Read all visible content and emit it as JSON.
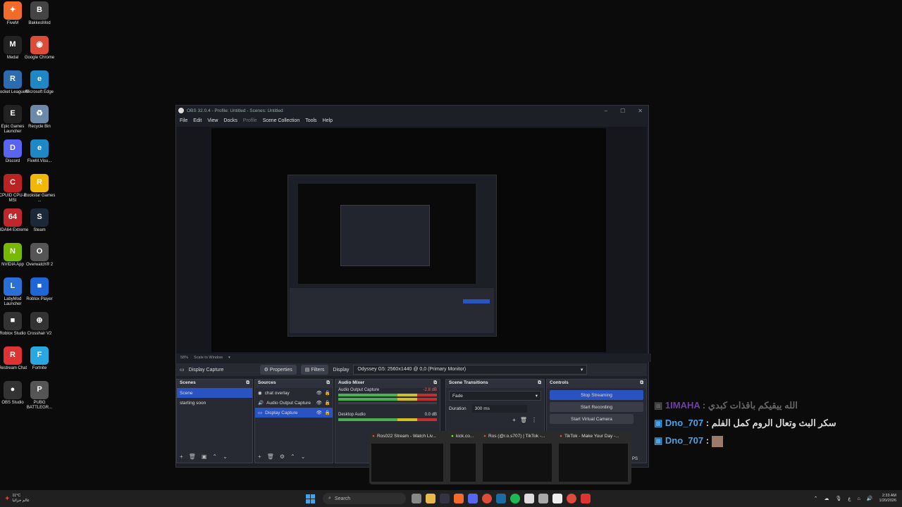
{
  "desktop": {
    "icons": [
      {
        "label": "FiveM",
        "color": "#f26b2a",
        "glyph": "✦"
      },
      {
        "label": "BakkesMod",
        "color": "#444",
        "glyph": "B"
      },
      {
        "label": "Medal",
        "color": "#222",
        "glyph": "M"
      },
      {
        "label": "Google Chrome",
        "color": "#dd4b39",
        "glyph": "◉"
      },
      {
        "label": "Rocket League®",
        "color": "#2b6cb0",
        "glyph": "R"
      },
      {
        "label": "Microsoft Edge",
        "color": "#1e88c7",
        "glyph": "e"
      },
      {
        "label": "Epic Games Launcher",
        "color": "#222",
        "glyph": "E"
      },
      {
        "label": "Recycle Bin",
        "color": "#6c8aa8",
        "glyph": "♻"
      },
      {
        "label": "Discord",
        "color": "#5865f2",
        "glyph": "D"
      },
      {
        "label": "FiveM.Visu...",
        "color": "#1e88c7",
        "glyph": "e"
      },
      {
        "label": "CPUID CPU-Z MSI",
        "color": "#b22",
        "glyph": "C"
      },
      {
        "label": "Rockstar Games ...",
        "color": "#f2b705",
        "glyph": "R"
      },
      {
        "label": "AIDA64 Extreme",
        "color": "#c0272d",
        "glyph": "64"
      },
      {
        "label": "Steam",
        "color": "#1b2838",
        "glyph": "S"
      },
      {
        "label": "NVIDIA App",
        "color": "#76b900",
        "glyph": "N"
      },
      {
        "label": "Overwatch® 2",
        "color": "#555",
        "glyph": "O"
      },
      {
        "label": "LabyMod Launcher",
        "color": "#2a6fd6",
        "glyph": "L"
      },
      {
        "label": "Roblox Player",
        "color": "#1e66d6",
        "glyph": "■"
      },
      {
        "label": "Roblox Studio",
        "color": "#333",
        "glyph": "■"
      },
      {
        "label": "Crosshair V2",
        "color": "#333",
        "glyph": "⊕"
      },
      {
        "label": "Restream Chat",
        "color": "#d33",
        "glyph": "R"
      },
      {
        "label": "Fortnite",
        "color": "#2aa7e0",
        "glyph": "F"
      },
      {
        "label": "OBS Studio",
        "color": "#333",
        "glyph": "●"
      },
      {
        "label": "PUBG BATTLEGR...",
        "color": "#555",
        "glyph": "P"
      }
    ]
  },
  "obs": {
    "title": "OBS 32.0.4 - Profile: Untitled - Scenes: Untitled",
    "menu": [
      "File",
      "Edit",
      "View",
      "Docks",
      "Profile",
      "Scene Collection",
      "Tools",
      "Help"
    ],
    "zoom": "58%",
    "scale_mode": "Scale to Window",
    "source_name": "Display Capture",
    "properties_label": "Properties",
    "filters_label": "Filters",
    "display_label": "Display",
    "display_value": "Odyssey G5: 2560x1440 @ 0,0 (Primary Monitor)",
    "scenes": {
      "title": "Scenes",
      "items": [
        "Scene",
        "starting soon"
      ]
    },
    "sources": {
      "title": "Sources",
      "items": [
        "chat overlay",
        "Audio Output Capture",
        "Display Capture"
      ]
    },
    "mixer": {
      "title": "Audio Mixer",
      "channels": [
        {
          "name": "Audio Output Capture",
          "db": "-2.8 dB"
        },
        {
          "name": "Desktop Audio",
          "db": "0.0 dB"
        }
      ]
    },
    "transitions": {
      "title": "Scene Transitions",
      "type": "Fade",
      "duration_label": "Duration",
      "duration": "300 ms"
    },
    "controls": {
      "title": "Controls",
      "stop_streaming": "Stop Streaming",
      "start_recording": "Start Recording",
      "start_virtual_camera": "Start Virtual Camera"
    },
    "status_fps": "PS"
  },
  "chat": [
    {
      "user": "1IMAHA",
      "sep": ":",
      "msg": "الله ييقيكم باقذات كبدي",
      "dim": true
    },
    {
      "user": "Dno_707",
      "sep": ":",
      "msg": "سكر البث وتعال الروم كمل الفلم",
      "dim": false
    },
    {
      "user": "Dno_707",
      "sep": ":",
      "msg": "",
      "dim": false
    }
  ],
  "thumbnails": [
    {
      "title": "Ros022 Stream - Watch Liv..."
    },
    {
      "title": "kick.co..."
    },
    {
      "title": "Ros (@r.o.s707) | TikTok -..."
    },
    {
      "title": "TikTok - Make Your Day -..."
    }
  ],
  "taskbar": {
    "weather_temp": "11°C",
    "weather_text": "غالم جزائيا",
    "search_placeholder": "Search",
    "time": "2:33 AM",
    "date": "1/20/2026",
    "lang": "ع"
  }
}
